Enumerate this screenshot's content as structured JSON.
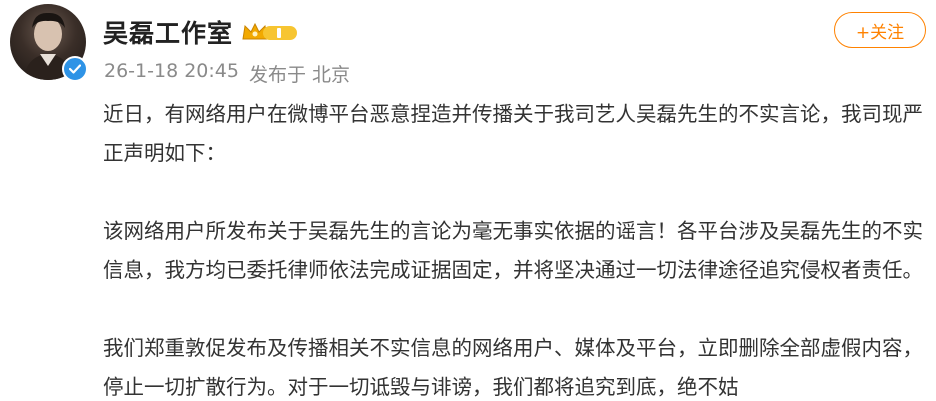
{
  "header": {
    "name": "吴磊工作室",
    "vip_badge": "vip-crown-badge",
    "timestamp": "26-1-18 20:45",
    "source": "发布于",
    "location": "北京",
    "follow_label": "+关注"
  },
  "post": {
    "paragraphs": [
      "近日，有网络用户在微博平台恶意捏造并传播关于我司艺人吴磊先生的不实言论，我司现严正声明如下：",
      "该网络用户所发布关于吴磊先生的言论为毫无事实依据的谣言！各平台涉及吴磊先生的不实信息，我方均已委托律师依法完成证据固定，并将坚决通过一切法律途径追究侵权者责任。",
      "我们郑重敦促发布及传播相关不实信息的网络用户、媒体及平台，立即删除全部虚假内容，停止一切扩散行为。对于一切诋毁与诽谤，我们都将追究到底，绝不姑"
    ]
  },
  "colors": {
    "accent": "#ff8200",
    "verified": "#2e93e6",
    "meta": "#8a8a8a"
  }
}
